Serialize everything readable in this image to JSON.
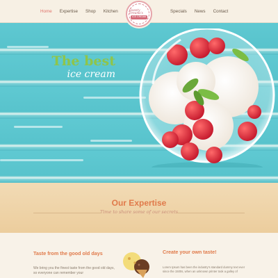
{
  "nav": {
    "left": [
      "Home",
      "Expertise",
      "Shop",
      "Kitchen"
    ],
    "right": [
      "Specials",
      "News",
      "Contact"
    ],
    "active": "Home"
  },
  "logo": {
    "top": "Sweety Dreams's",
    "bottom": "ICE CREAM"
  },
  "hero": {
    "line1": "The best",
    "line2": "ice cream"
  },
  "expertise": {
    "title": "Our Expertise",
    "subtitle": "Time to share some of our secrets"
  },
  "columns": {
    "left": {
      "title": "Taste from the good old days",
      "text": "We bring you the finest taste from the good old days, so everyone can remember your"
    },
    "right": {
      "title": "Create your own taste!",
      "text": "Lorem Ipsum has been the industry's standard dummy text ever since the 1500s, when an unknown printer took a galley of"
    }
  },
  "colors": {
    "accent": "#e07a4a",
    "hero_green": "#8fc54a",
    "wood_blue": "#5fc9d2",
    "raspberry": "#e63a4a"
  }
}
